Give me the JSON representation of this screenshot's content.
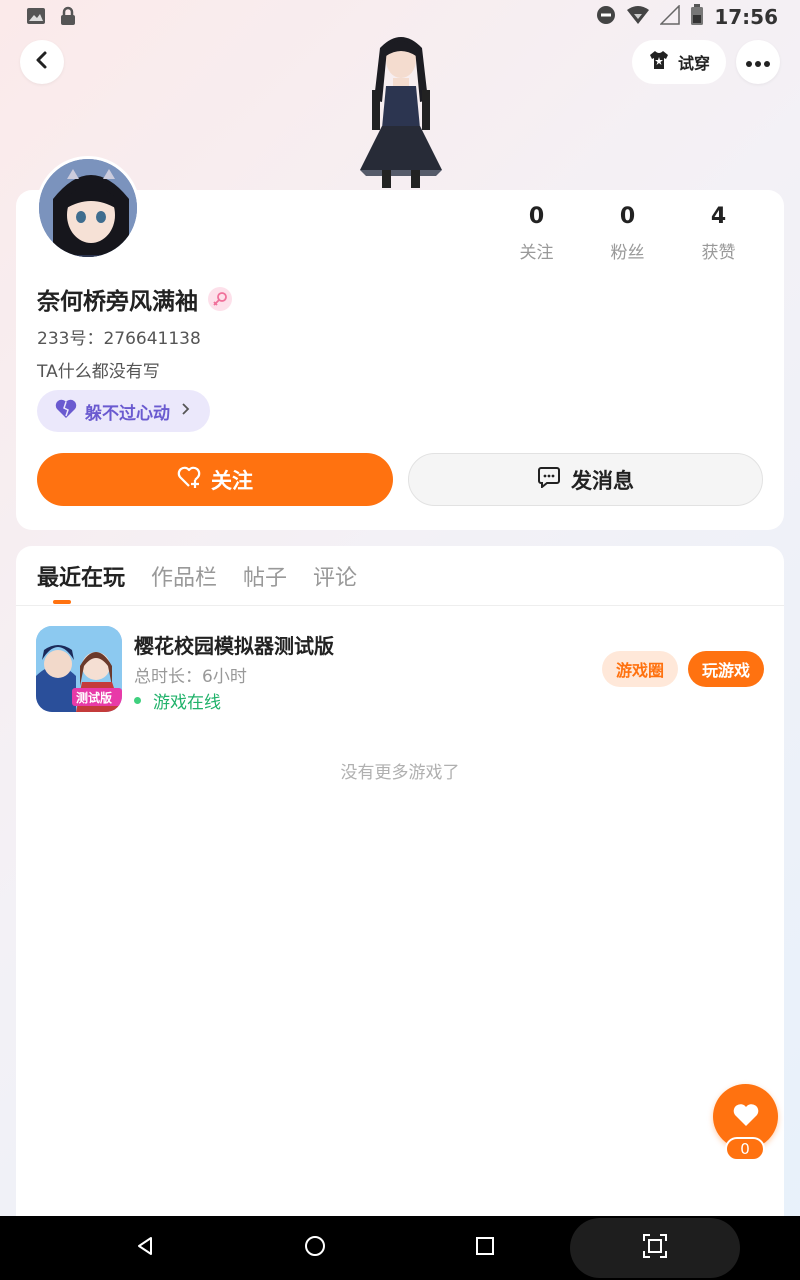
{
  "status_bar": {
    "time": "17:56",
    "left_icons": [
      "image-icon",
      "lock-icon"
    ],
    "right_icons": [
      "do-not-disturb-icon",
      "wifi-icon",
      "signal-icon",
      "battery-icon"
    ]
  },
  "top_bar": {
    "try_on_label": "试穿",
    "back_icon": "chevron-left-icon",
    "more_icon": "more-horizontal-icon"
  },
  "profile": {
    "nickname": "奈何桥旁风满袖",
    "gender": "female",
    "uid": "233号：276641138",
    "bio": "TA什么都没有写",
    "tag": "躲不过心动",
    "stats": [
      {
        "value": "0",
        "label": "关注"
      },
      {
        "value": "0",
        "label": "粉丝"
      },
      {
        "value": "4",
        "label": "获赞"
      }
    ],
    "follow_label": "关注",
    "message_label": "发消息"
  },
  "tabs": [
    {
      "label": "最近在玩",
      "active": true
    },
    {
      "label": "作品栏",
      "active": false
    },
    {
      "label": "帖子",
      "active": false
    },
    {
      "label": "评论",
      "active": false
    }
  ],
  "games": [
    {
      "title": "樱花校园模拟器测试版",
      "duration": "总时长：6小时",
      "status": "游戏在线",
      "icon_badge": "测试版",
      "circle_label": "游戏圈",
      "play_label": "玩游戏"
    }
  ],
  "no_more_text": "没有更多游戏了",
  "like_fab": {
    "count": "0"
  },
  "colors": {
    "accent": "#ff7210",
    "online": "#20b26a",
    "tag_purple": "#6a5ad0"
  }
}
